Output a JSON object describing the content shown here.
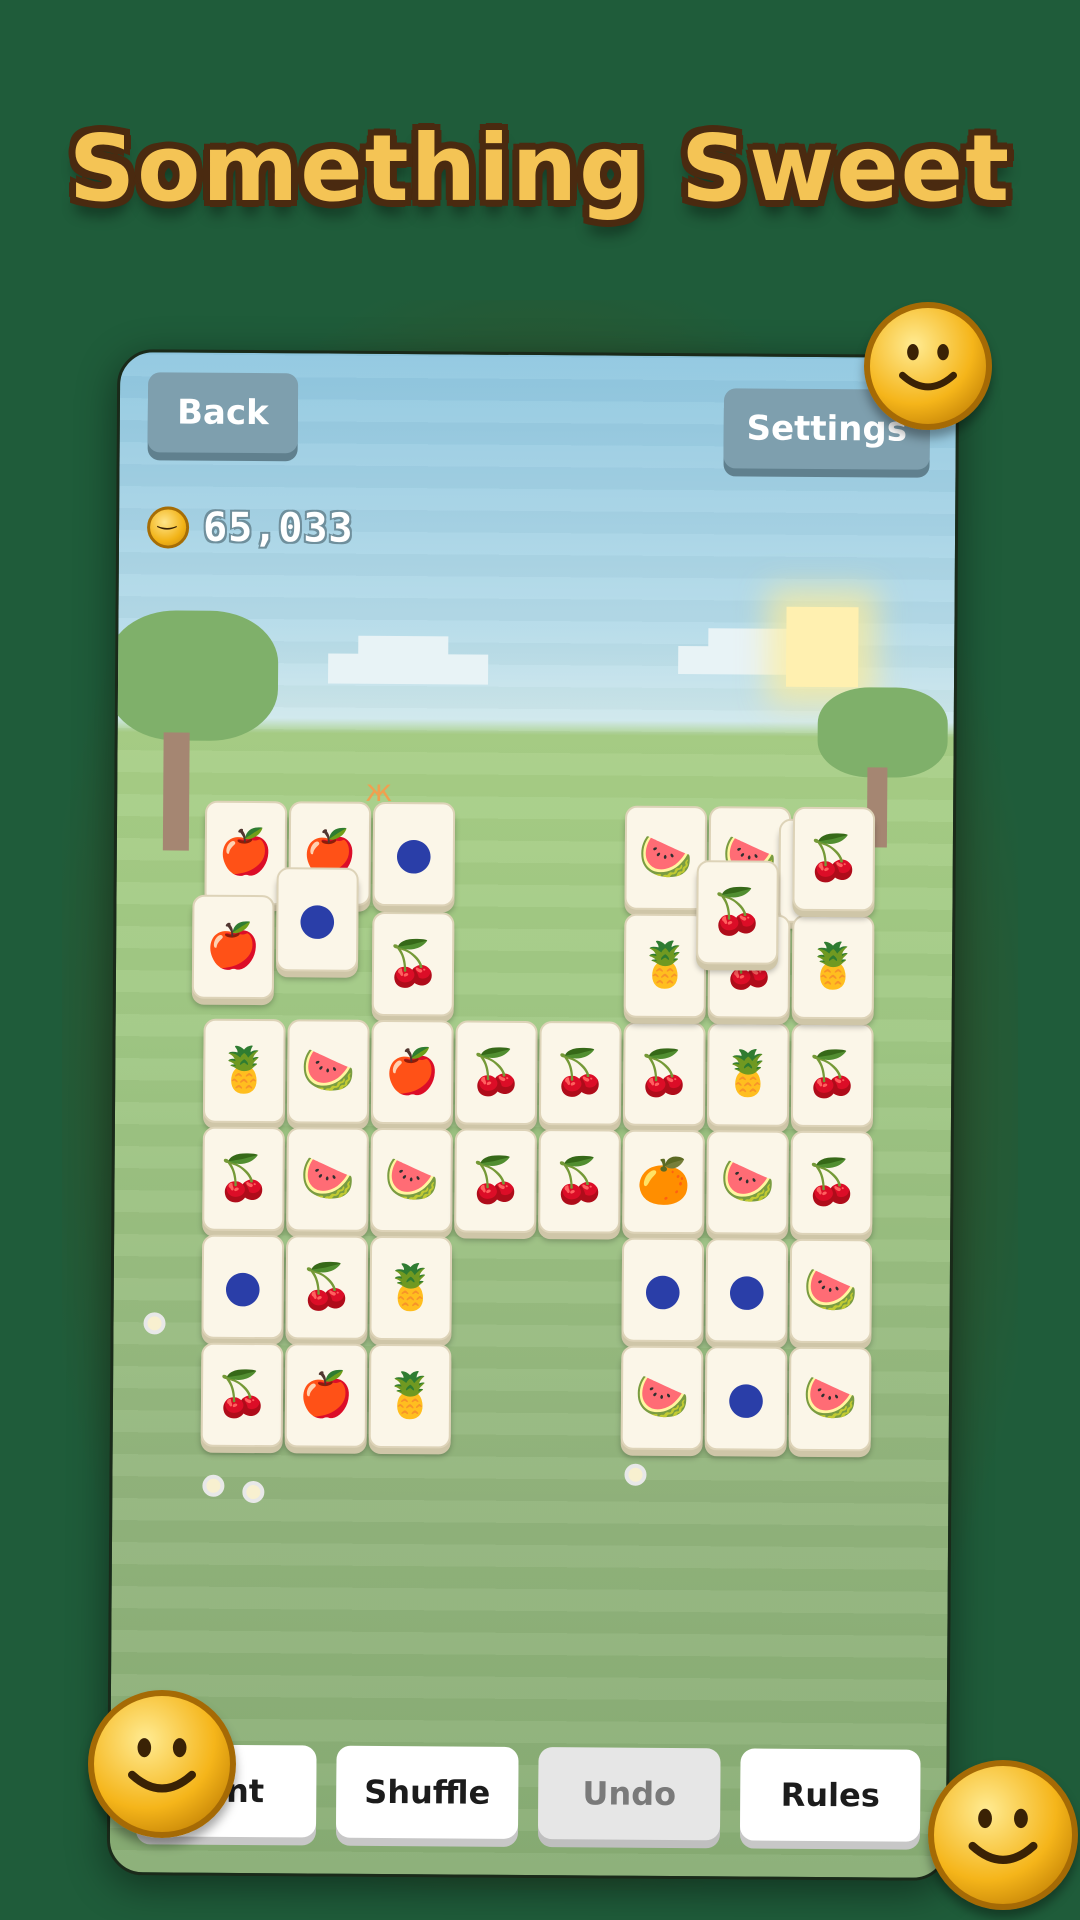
{
  "title": "Something Sweet",
  "header": {
    "back_label": "Back",
    "settings_label": "Settings",
    "coin_balance": "65,033"
  },
  "board": {
    "tiles": [
      {
        "fruit": "apple",
        "glyph": "🍎"
      },
      {
        "fruit": "apple",
        "glyph": "🍎"
      },
      {
        "fruit": "blueberry",
        "glyph": "●"
      },
      {
        "fruit": "apple",
        "glyph": "🍎"
      },
      {
        "fruit": "blueberry",
        "glyph": "●"
      },
      {
        "fruit": "cherry",
        "glyph": "🍒"
      },
      {
        "fruit": "pineapple",
        "glyph": "🍍"
      },
      {
        "fruit": "watermelon",
        "glyph": "🍉"
      },
      {
        "fruit": "apple",
        "glyph": "🍎"
      },
      {
        "fruit": "cherry",
        "glyph": "🍒"
      },
      {
        "fruit": "cherry",
        "glyph": "🍒"
      },
      {
        "fruit": "cherry",
        "glyph": "🍒"
      },
      {
        "fruit": "pineapple",
        "glyph": "🍍"
      },
      {
        "fruit": "cherry",
        "glyph": "🍒"
      },
      {
        "fruit": "cherry",
        "glyph": "🍒"
      },
      {
        "fruit": "watermelon",
        "glyph": "🍉"
      },
      {
        "fruit": "watermelon",
        "glyph": "🍉"
      },
      {
        "fruit": "cherry",
        "glyph": "🍒"
      },
      {
        "fruit": "cherry",
        "glyph": "🍒"
      },
      {
        "fruit": "orange",
        "glyph": "🍊"
      },
      {
        "fruit": "watermelon",
        "glyph": "🍉"
      },
      {
        "fruit": "cherry",
        "glyph": "🍒"
      },
      {
        "fruit": "blueberry",
        "glyph": "●"
      },
      {
        "fruit": "cherry",
        "glyph": "🍒"
      },
      {
        "fruit": "pineapple",
        "glyph": "🍍"
      },
      {
        "fruit": "blueberry",
        "glyph": "●"
      },
      {
        "fruit": "blueberry",
        "glyph": "●"
      },
      {
        "fruit": "watermelon",
        "glyph": "🍉"
      },
      {
        "fruit": "cherry",
        "glyph": "🍒"
      },
      {
        "fruit": "apple",
        "glyph": "🍎"
      },
      {
        "fruit": "pineapple",
        "glyph": "🍍"
      },
      {
        "fruit": "watermelon",
        "glyph": "🍉"
      },
      {
        "fruit": "blueberry",
        "glyph": "●"
      },
      {
        "fruit": "watermelon",
        "glyph": "🍉"
      },
      {
        "fruit": "watermelon",
        "glyph": "🍉"
      },
      {
        "fruit": "watermelon",
        "glyph": "🍉"
      },
      {
        "fruit": "cherry",
        "glyph": "🍒"
      },
      {
        "fruit": "pineapple",
        "glyph": "🍍"
      },
      {
        "fruit": "cherry",
        "glyph": "🍒"
      },
      {
        "fruit": "pineapple",
        "glyph": "🍍"
      },
      {
        "fruit": "cherry",
        "glyph": "🍒"
      },
      {
        "fruit": "cherry",
        "glyph": "🍒"
      }
    ]
  },
  "toolbar": {
    "hint_label": "Hint",
    "shuffle_label": "Shuffle",
    "undo_label": "Undo",
    "rules_label": "Rules"
  },
  "colors": {
    "background": "#1f5c3a",
    "title_fill": "#f4c455",
    "title_outline": "#4a2a10",
    "top_button": "#7e9fae",
    "coin_gold": "#f5b51a"
  }
}
